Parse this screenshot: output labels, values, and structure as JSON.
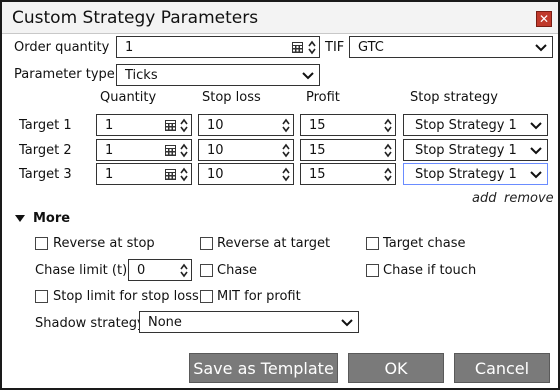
{
  "dialog": {
    "title": "Custom Strategy Parameters"
  },
  "order": {
    "quantity_label": "Order quantity",
    "quantity_value": "1",
    "tif_label": "TIF",
    "tif_value": "GTC"
  },
  "param": {
    "label": "Parameter type",
    "value": "Ticks"
  },
  "columns": {
    "quantity": "Quantity",
    "stop_loss": "Stop loss",
    "profit": "Profit",
    "stop_strategy": "Stop strategy"
  },
  "targets": [
    {
      "label": "Target 1",
      "quantity": "1",
      "stop_loss": "10",
      "profit": "15",
      "strategy": "Stop Strategy 1"
    },
    {
      "label": "Target 2",
      "quantity": "1",
      "stop_loss": "10",
      "profit": "15",
      "strategy": "Stop Strategy 1"
    },
    {
      "label": "Target 3",
      "quantity": "1",
      "stop_loss": "10",
      "profit": "15",
      "strategy": "Stop Strategy 1"
    }
  ],
  "links": {
    "add": "add",
    "remove": "remove"
  },
  "more": {
    "label": "More",
    "reverse_at_stop": "Reverse at stop",
    "reverse_at_target": "Reverse at target",
    "target_chase": "Target chase",
    "chase_limit_label": "Chase limit (t)",
    "chase_limit_value": "0",
    "chase": "Chase",
    "chase_if_touch": "Chase if touch",
    "stop_limit": "Stop limit for stop loss",
    "mit_profit": "MIT for profit",
    "shadow_label": "Shadow strategy",
    "shadow_value": "None"
  },
  "buttons": {
    "save_template": "Save as Template",
    "ok": "OK",
    "cancel": "Cancel"
  },
  "colors": {
    "button_bg": "#7a7a7a",
    "close_bg": "#c0392b",
    "focus_border": "#6a8cff"
  }
}
